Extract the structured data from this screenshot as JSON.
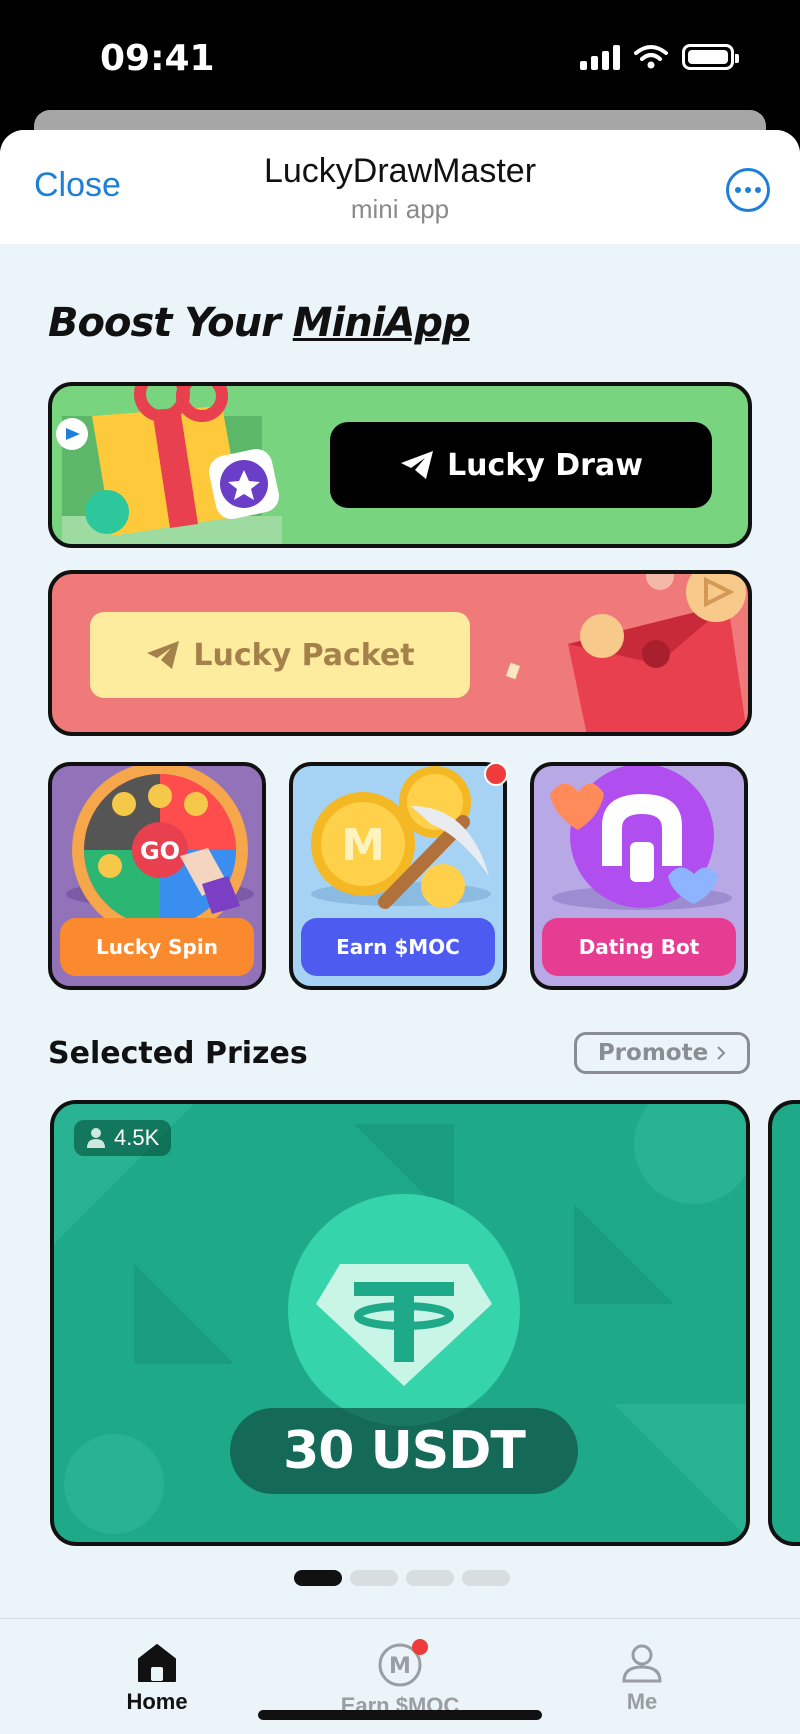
{
  "status_bar": {
    "time": "09:41"
  },
  "header": {
    "close_label": "Close",
    "title": "LuckyDrawMaster",
    "subtitle": "mini app"
  },
  "main": {
    "heading_prefix": "Boost Your",
    "heading_emphasis": "MiniApp",
    "lucky_draw_label": "Lucky Draw",
    "lucky_packet_label": "Lucky Packet",
    "tiles": [
      {
        "label": "Lucky Spin",
        "wheel_text": "GO"
      },
      {
        "label": "Earn $MOC",
        "coin_letter": "M"
      },
      {
        "label": "Dating Bot"
      }
    ]
  },
  "prizes": {
    "section_title": "Selected Prizes",
    "promote_label": "Promote",
    "card": {
      "viewers": "4.5K",
      "prize_label": "30 USDT"
    },
    "page_count": 4,
    "active_page": 1
  },
  "tabbar": {
    "items": [
      {
        "label": "Home",
        "active": true
      },
      {
        "label": "Earn $MOC",
        "active": false,
        "badge": true
      },
      {
        "label": "Me",
        "active": false
      }
    ]
  },
  "colors": {
    "accent": "#1e7fd9",
    "lucky_draw_bg": "#78d47e",
    "lucky_packet_bg": "#f07a7a",
    "lucky_spin_button": "#fb8a2e",
    "earn_button": "#4d5bf0",
    "dating_button": "#e63d92",
    "prize_bg": "#1ea988",
    "badge_red": "#ef3b3b"
  }
}
